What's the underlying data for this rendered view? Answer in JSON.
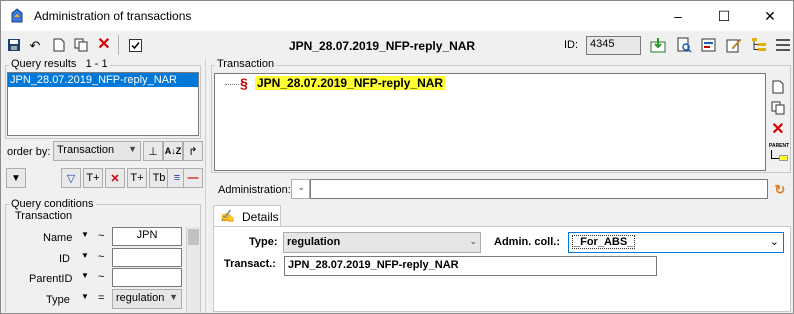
{
  "window": {
    "title": "Administration of transactions",
    "minimize": "–",
    "maximize": "☐",
    "close": "✕"
  },
  "toolbar": {
    "record_title": "JPN_28.07.2019_NFP-reply_NAR",
    "id_label": "ID:",
    "id_value": "4345"
  },
  "left": {
    "query_results_label": "Query results",
    "query_results_count": "1 - 1",
    "results": [
      "JPN_28.07.2019_NFP-reply_NAR"
    ],
    "order_by_label": "order by:",
    "order_by_value": "Transaction",
    "query_conditions_label": "Query conditions",
    "section_label": "Transaction",
    "conditions": [
      {
        "label": "Name",
        "op": "~",
        "value": "JPN"
      },
      {
        "label": "ID",
        "op": "~",
        "value": ""
      },
      {
        "label": "ParentID",
        "op": "~",
        "value": ""
      },
      {
        "label": "Type",
        "op": "=",
        "value": "regulation"
      }
    ]
  },
  "right": {
    "transaction_group_label": "Transaction",
    "tree_node": "JPN_28.07.2019_NFP-reply_NAR",
    "tree_symbol": "§",
    "administration_label": "Administration:",
    "administration_value": "",
    "tab_details": "Details",
    "type_label": "Type:",
    "type_value": "regulation",
    "admin_coll_label": "Admin. coll.:",
    "admin_coll_value": "_For_ABS_",
    "transact_label": "Transact.:",
    "transact_value": "JPN_28.07.2019_NFP-reply_NAR",
    "parent_label": "PARENT"
  },
  "colors": {
    "highlight": "#ffff33",
    "selection": "#0078d7",
    "symbol_red": "#c00000"
  }
}
